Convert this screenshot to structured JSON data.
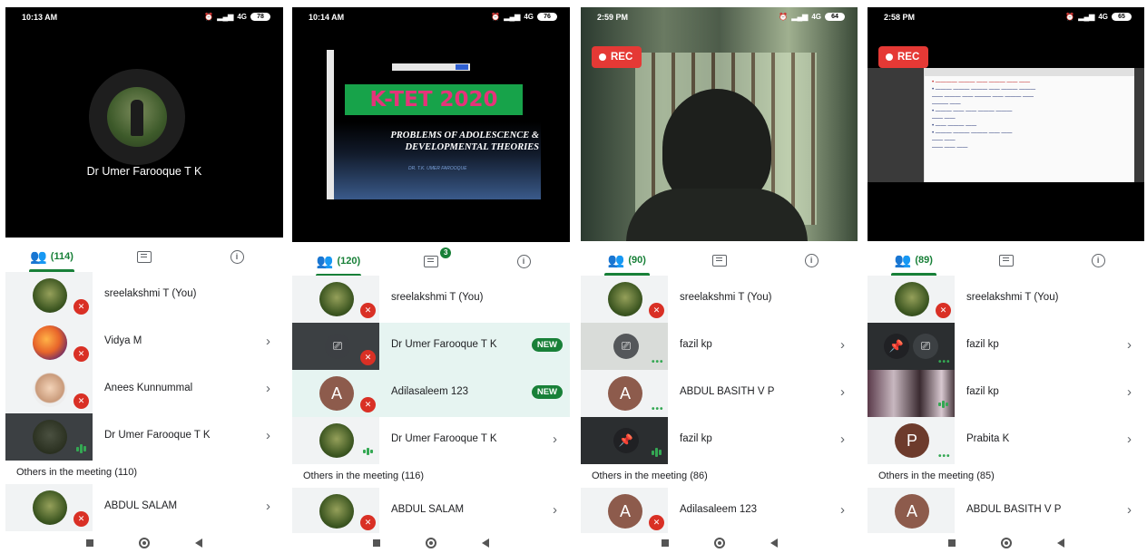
{
  "screens": [
    {
      "status": {
        "time": "10:13 AM",
        "network": "4G",
        "battery": "78"
      },
      "presenter_name": "Dr Umer Farooque T K",
      "tabs": {
        "people_count": "(114)",
        "chat_badge": ""
      },
      "rows": [
        {
          "name": "sreelakshmi T (You)"
        },
        {
          "name": "Vidya M"
        },
        {
          "name": "Anees Kunnummal"
        },
        {
          "name": "Dr Umer Farooque T K"
        }
      ],
      "others_label": "Others in the meeting (110)",
      "others_rows": [
        {
          "name": "ABDUL SALAM"
        }
      ]
    },
    {
      "status": {
        "time": "10:14 AM",
        "network": "4G",
        "battery": "76"
      },
      "slide": {
        "title": "K-TET 2020",
        "subtitle": "PROBLEMS OF ADOLESCENCE & DEVELOPMENTAL THEORIES",
        "author": "DR. T.K. UMER FAROOQUE"
      },
      "tabs": {
        "people_count": "(120)",
        "chat_badge": "3"
      },
      "rows": [
        {
          "name": "sreelakshmi T (You)"
        },
        {
          "name": "Dr Umer Farooque T K",
          "tag": "NEW"
        },
        {
          "name": "Adilasaleem 123",
          "tag": "NEW",
          "initial": "A"
        },
        {
          "name": "Dr Umer Farooque T K"
        }
      ],
      "others_label": "Others in the meeting (116)",
      "others_rows": [
        {
          "name": "ABDUL SALAM"
        }
      ]
    },
    {
      "status": {
        "time": "2:59 PM",
        "network": "4G",
        "battery": "64"
      },
      "rec_label": "REC",
      "tabs": {
        "people_count": "(90)",
        "chat_badge": ""
      },
      "rows": [
        {
          "name": "sreelakshmi T (You)"
        },
        {
          "name": "fazil kp"
        },
        {
          "name": "ABDUL BASITH V P",
          "initial": "A"
        },
        {
          "name": "fazil kp"
        }
      ],
      "others_label": "Others in the meeting (86)",
      "others_rows": [
        {
          "name": "Adilasaleem 123",
          "initial": "A"
        }
      ]
    },
    {
      "status": {
        "time": "2:58 PM",
        "network": "4G",
        "battery": "65"
      },
      "rec_label": "REC",
      "tabs": {
        "people_count": "(89)",
        "chat_badge": ""
      },
      "rows": [
        {
          "name": "sreelakshmi T (You)"
        },
        {
          "name": "fazil kp"
        },
        {
          "name": "fazil kp"
        },
        {
          "name": "Prabita K",
          "initial": "P"
        }
      ],
      "others_label": "Others in the meeting (85)",
      "others_rows": [
        {
          "name": "ABDUL BASITH V P",
          "initial": "A"
        }
      ]
    }
  ],
  "icons": {
    "people": "people-icon",
    "chat": "chat-icon",
    "info": "info-icon",
    "mic_off": "mic-off-icon",
    "present": "present-screen-icon",
    "pin": "pin-icon",
    "chevron": "chevron-right-icon"
  },
  "colors": {
    "accent": "#188038",
    "mute_red": "#d93025",
    "rec_red": "#e53935",
    "highlight_row": "#e6f4f1"
  }
}
